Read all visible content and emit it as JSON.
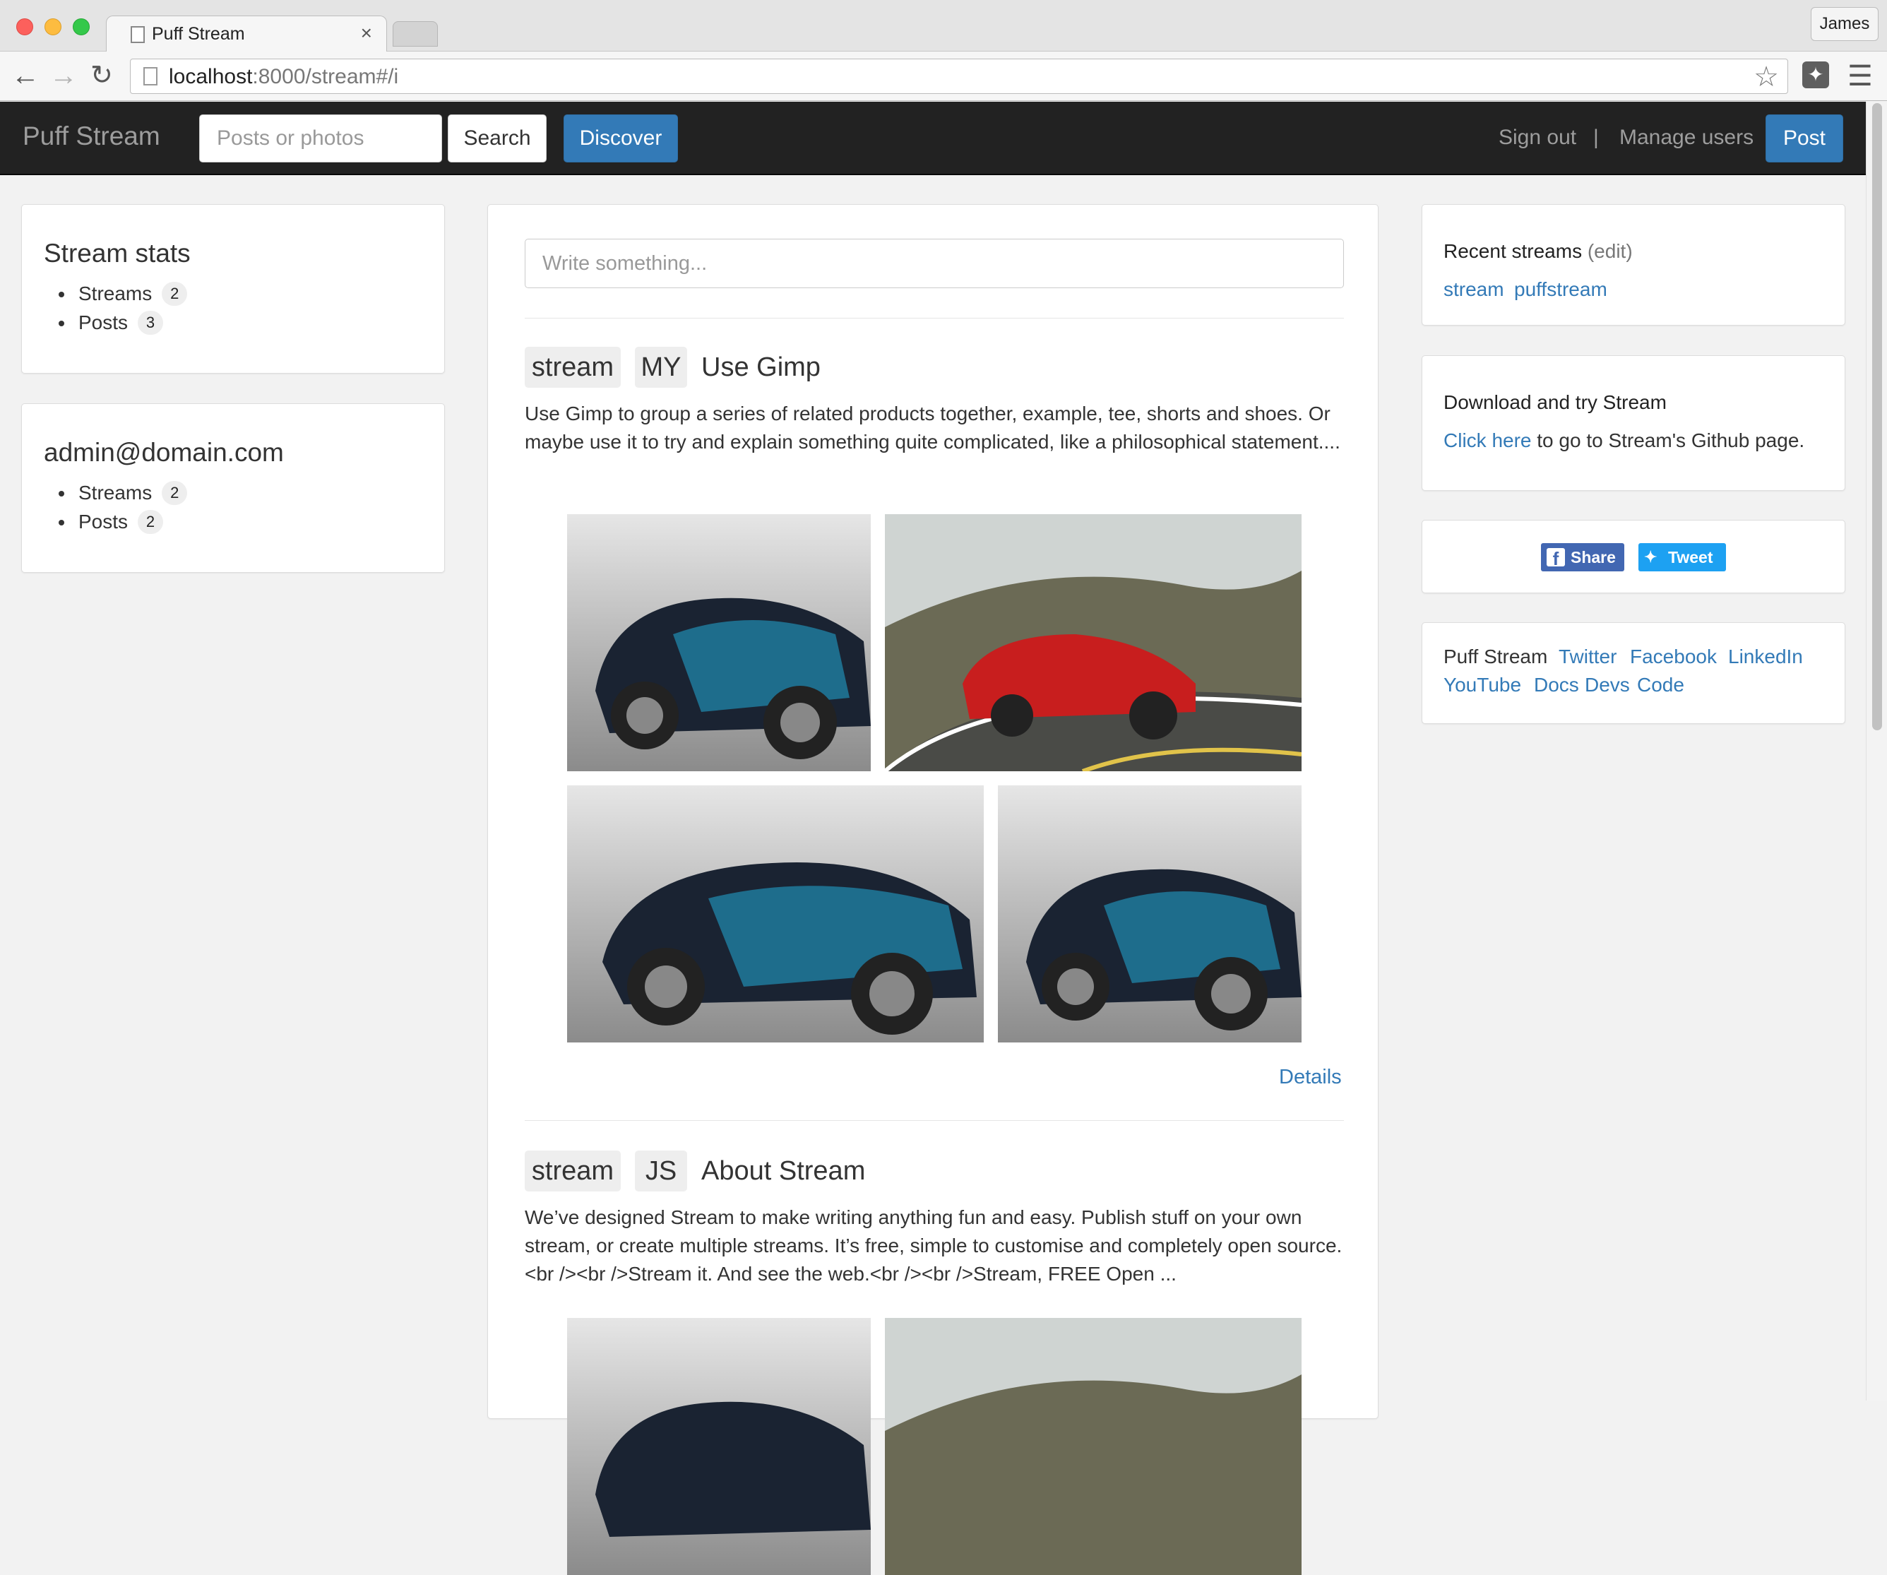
{
  "browser": {
    "tab_title": "Puff Stream",
    "tab_close": "×",
    "profile_name": "James",
    "url_host": "localhost",
    "url_rest": ":8000/stream#/i"
  },
  "navbar": {
    "brand": "Puff Stream",
    "search_placeholder": "Posts or photos",
    "search_button": "Search",
    "discover_button": "Discover",
    "sign_out": "Sign out",
    "separator": "|",
    "manage_users": "Manage users",
    "post_button": "Post"
  },
  "left": {
    "stream_stats": {
      "title": "Stream stats",
      "items": [
        {
          "label": "Streams",
          "count": "2"
        },
        {
          "label": "Posts",
          "count": "3"
        }
      ]
    },
    "user": {
      "title": "admin@domain.com",
      "items": [
        {
          "label": "Streams",
          "count": "2"
        },
        {
          "label": "Posts",
          "count": "2"
        }
      ]
    }
  },
  "feed": {
    "compose_placeholder": "Write something...",
    "posts": [
      {
        "stream": "stream",
        "initials": "MY",
        "title": "Use Gimp",
        "body": "Use Gimp to group a series of related products together, example, tee, shorts and shoes. Or maybe use it to try and explain something quite complicated, like a philosophical statement....",
        "details": "Details"
      },
      {
        "stream": "stream",
        "initials": "JS",
        "title": "About Stream",
        "body": "We’ve designed Stream to make writing anything fun and easy. Publish stuff on your own stream, or create multiple streams. It’s free, simple to customise and completely open source.<br /><br />Stream it. And see the web.<br /><br />Stream, FREE Open ..."
      }
    ]
  },
  "right": {
    "recent": {
      "title": "Recent streams",
      "edit": "(edit)",
      "streams": [
        "stream",
        "puffstream"
      ]
    },
    "download": {
      "title": "Download and try Stream",
      "link": "Click here",
      "text": " to go to Stream's Github page."
    },
    "share": {
      "facebook": "Share",
      "twitter": "Tweet"
    },
    "footer": {
      "brand": "Puff Stream",
      "links": [
        "Twitter",
        "Facebook",
        "LinkedIn",
        "YouTube",
        "Docs",
        "Devs",
        "Code"
      ]
    }
  },
  "colors": {
    "primary": "#337ab7",
    "navbar_bg": "#222222",
    "page_bg": "#f2f2f2"
  },
  "icons": [
    "back-icon",
    "forward-icon",
    "reload-icon",
    "page-icon",
    "star-icon",
    "extension-icon",
    "menu-icon",
    "facebook-icon",
    "twitter-icon"
  ]
}
